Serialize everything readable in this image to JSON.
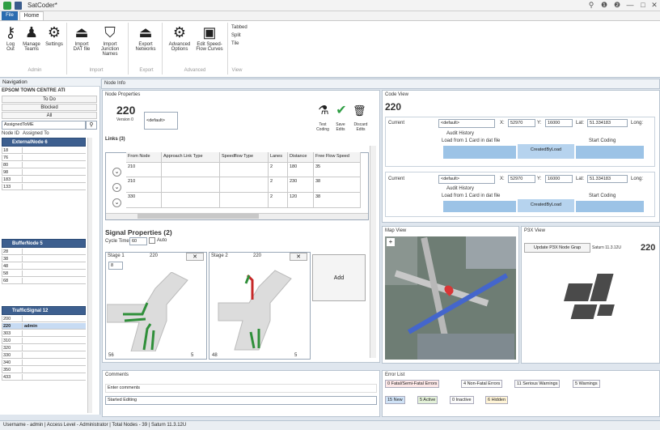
{
  "window": {
    "title": "SatCoder*",
    "controls": [
      "⚲",
      "❶",
      "❷",
      "—",
      "□",
      "✕"
    ]
  },
  "tabs": {
    "file": "File",
    "home": "Home"
  },
  "ribbon": {
    "buttons": [
      {
        "label": "Log Out",
        "icon": "key-icon"
      },
      {
        "label": "Manage Teams",
        "icon": "team-icon"
      },
      {
        "label": "Settings",
        "icon": "gear-icon"
      },
      {
        "label": "Import DAT file",
        "icon": "import-icon"
      },
      {
        "label": "Import Junction Names",
        "icon": "binoculars-icon"
      },
      {
        "label": "Export Networks",
        "icon": "export-icon"
      },
      {
        "label": "Advanced Options",
        "icon": "gear-icon"
      },
      {
        "label": "Edit Speed-Flow Curves",
        "icon": "edit-icon"
      }
    ],
    "view_options": [
      "Tabbed",
      "Split",
      "Tile"
    ],
    "groups": [
      "Admin",
      "Import",
      "Export",
      "Advanced",
      "View"
    ]
  },
  "nav": {
    "title": "Navigation",
    "area": "EPSOM TOWN CENTRE ATI",
    "buttons": [
      "To Do",
      "Blocked",
      "All"
    ],
    "filter": "AssignedToME",
    "cols": [
      "Node ID",
      "Assigned To"
    ],
    "groups": [
      {
        "name": "ExternalNode",
        "count": "6",
        "rows": [
          "18",
          "76",
          "80",
          "98",
          "183",
          "133"
        ]
      },
      {
        "name": "BufferNode",
        "count": "5",
        "rows": [
          "28",
          "38",
          "48",
          "58",
          "68"
        ]
      },
      {
        "name": "TrafficSignal",
        "count": "12",
        "rows": [
          "200",
          "220",
          "303",
          "310",
          "320",
          "330",
          "340",
          "350",
          "433"
        ],
        "selected_user": "admin"
      }
    ]
  },
  "node_info": {
    "title": "Node Info",
    "props_title": "Node Properties",
    "node_id": "220",
    "version": "Version 0",
    "default": "<default>",
    "actions": [
      "Test Coding",
      "Save Edits",
      "Discard Edits"
    ],
    "links_title": "Links (3)",
    "links_cols": [
      "From Node",
      "Approach Link Type",
      "Speedflow Type",
      "Lanes",
      "Distance",
      "Free Flow Speed"
    ],
    "links": [
      [
        "210",
        "",
        "",
        "2",
        "180",
        "35"
      ],
      [
        "210",
        "",
        "",
        "2",
        "230",
        "38"
      ],
      [
        "330",
        "",
        "",
        "2",
        "120",
        "38"
      ]
    ],
    "signal_title": "Signal Properties (2)",
    "cycle_label": "Cycle Time",
    "cycle_value": "60",
    "auto_label": "Auto",
    "stages": [
      {
        "name": "Stage 1",
        "node": "220",
        "time": "8",
        "bottom": "56",
        "bottom_right": "5"
      },
      {
        "name": "Stage 2",
        "node": "220",
        "time": "",
        "bottom": "48",
        "bottom_right": "5"
      }
    ],
    "add_label": "Add",
    "comments_title": "Comments",
    "comments_placeholder": "Enter comments",
    "comments_status": "Started Editing"
  },
  "code_view": {
    "title": "Code View",
    "node_id": "220",
    "rows": [
      {
        "label": "Current",
        "default": "<default>",
        "x": "52970",
        "y": "16000",
        "lat": "51.334183",
        "lng": "Long:"
      },
      {
        "label": "Current",
        "default": "<default>",
        "x": "52970",
        "y": "16000",
        "lat": "51.334183",
        "lng": "Long:"
      }
    ],
    "history": "Audit History",
    "loaded": "Load from 1 Card in dat file",
    "created": "CreatedByLoad",
    "coding": "Start Coding"
  },
  "map": {
    "title": "Map View"
  },
  "p3x": {
    "title": "P3X View",
    "button": "Update P3X Node Grap",
    "sat": "Saturn 11.3.12U",
    "node": "220"
  },
  "errors": {
    "title": "Error List",
    "tabs": [
      "0 Fatal/Semi-Fatal Errors",
      "4 Non-Fatal Errors",
      "11 Serious Warnings",
      "5 Warnings"
    ],
    "filters": [
      "15 New",
      "5 Active",
      "0 Inactive",
      "6 Hidden"
    ]
  },
  "statusbar": "Username - admin | Access Level - Administrator | Total Nodes - 39 | Saturn 11.3.12U",
  "colors": {
    "accent": "#2b6cb0",
    "grid_header": "#3d5f8f",
    "selected_row": "#c7dbf3",
    "arrow_fill": "#9cc3e6",
    "green_arrow": "#2f8f3a",
    "red_arrow": "#c62828"
  }
}
